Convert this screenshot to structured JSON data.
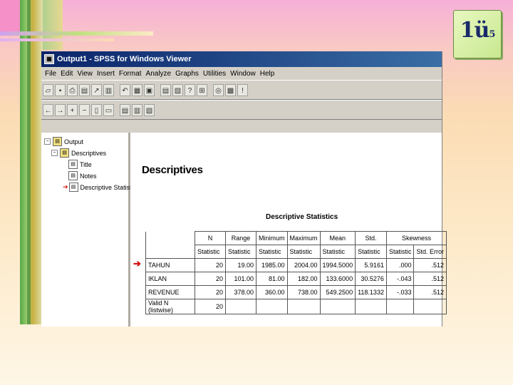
{
  "badge": {
    "number": "1ü",
    "sub": "5"
  },
  "window": {
    "title": "Output1 - SPSS for Windows Viewer",
    "menu": [
      "File",
      "Edit",
      "View",
      "Insert",
      "Format",
      "Analyze",
      "Graphs",
      "Utilities",
      "Window",
      "Help"
    ]
  },
  "tree": {
    "items": [
      {
        "label": "Output",
        "level": 0
      },
      {
        "label": "Descriptives",
        "level": 1
      },
      {
        "label": "Title",
        "level": 2
      },
      {
        "label": "Notes",
        "level": 2
      },
      {
        "label": "Descriptive Statistics",
        "level": 2
      }
    ]
  },
  "output": {
    "heading": "Descriptives",
    "table_title": "Descriptive Statistics",
    "header_top": [
      "N",
      "Range",
      "Minimum",
      "Maximum",
      "Mean",
      "Std.",
      "Skewness"
    ],
    "header_sub": [
      "Statistic",
      "Statistic",
      "Statistic",
      "Statistic",
      "Statistic",
      "Statistic",
      "Statistic",
      "Std. Error"
    ],
    "rows": [
      {
        "label": "TAHUN",
        "cells": [
          "20",
          "19.00",
          "1985.00",
          "2004.00",
          "1994.5000",
          "5.9161",
          ".000",
          ".512"
        ]
      },
      {
        "label": "IKLAN",
        "cells": [
          "20",
          "101.00",
          "81.00",
          "182.00",
          "133.6000",
          "30.5276",
          "-.043",
          ".512"
        ]
      },
      {
        "label": "REVENUE",
        "cells": [
          "20",
          "378.00",
          "360.00",
          "738.00",
          "549.2500",
          "118.1332",
          "-.033",
          ".512"
        ]
      },
      {
        "label": "Valid N (listwise)",
        "cells": [
          "20",
          "",
          "",
          "",
          "",
          "",
          "",
          ""
        ]
      }
    ]
  }
}
